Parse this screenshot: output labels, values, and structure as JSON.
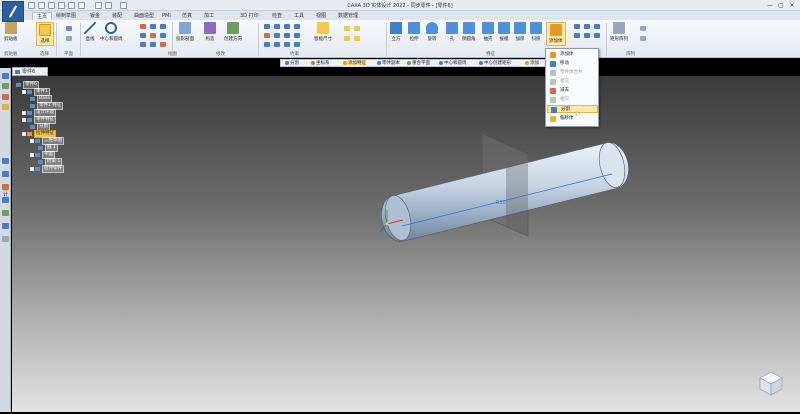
{
  "window": {
    "title": "CAXA 3D 实体设计 2022 - 同步零件 - [零件6]",
    "controls": [
      "—",
      "▢",
      "✕"
    ]
  },
  "tabs": [
    {
      "label": "主页",
      "active": true
    },
    {
      "label": "绘制草图"
    },
    {
      "label": "钣金"
    },
    {
      "label": "装配"
    },
    {
      "label": "曲面造型"
    },
    {
      "label": "PMI"
    },
    {
      "label": "仿真"
    },
    {
      "label": "加工"
    },
    {
      "label": "3D 打印"
    },
    {
      "label": "检查"
    },
    {
      "label": "工具"
    },
    {
      "label": "视图"
    },
    {
      "label": "数据管理"
    }
  ],
  "ribbon": {
    "buttons": {
      "clipboard": "剪贴板",
      "select": "选择",
      "line": "直线",
      "center_circle": "中心和圆周",
      "section_projection": "投影剖面",
      "project_ok": "构造",
      "create_direction": "创建方向",
      "smart_dimension": "智能尺寸",
      "cylinder": "立方",
      "stretch": "拉伸",
      "revolve": "旋转",
      "hole": "孔",
      "fillet": "倒圆角",
      "shell": "抽壳",
      "draft": "拔模",
      "thicken": "加厚",
      "sweep": "扫掠",
      "add_body": "添加体",
      "rect_array": "矩形阵列"
    },
    "groups": {
      "clipboard": "剪贴板",
      "select": "选择",
      "plane": "平面",
      "sketch": "绘图",
      "modify": "修改",
      "constraint": "约束",
      "features": "特征",
      "pattern": "阵列"
    }
  },
  "command_bar": {
    "items": [
      "分割",
      "坐标系",
      "添加特征",
      "零件副本",
      "重合平面",
      "中心和圆周",
      "中心创建矩形",
      "添加"
    ]
  },
  "document_tab": "零件6",
  "left_panel_label": "设计树",
  "tree": [
    {
      "label": "零件6",
      "indent": 0
    },
    {
      "label": "零件1",
      "indent": 1
    },
    {
      "label": "Base",
      "indent": 2
    },
    {
      "label": "零件1 特征",
      "indent": 2
    },
    {
      "label": "设计环境",
      "indent": 1
    },
    {
      "label": "零件特征",
      "indent": 1
    },
    {
      "label": "分割",
      "indent": 2
    },
    {
      "label": "拉伸特征",
      "indent": 1,
      "highlight": true
    },
    {
      "label": "二维草图",
      "indent": 2
    },
    {
      "label": "圆 1",
      "indent": 3
    },
    {
      "label": "平面",
      "indent": 2
    },
    {
      "label": "约束 1",
      "indent": 3
    },
    {
      "label": "拉伸零件",
      "indent": 2
    }
  ],
  "dropdown_menu": {
    "items": [
      {
        "label": "添加体",
        "disabled": false
      },
      {
        "label": "移动",
        "disabled": false
      },
      {
        "label": "零件体合并",
        "disabled": true
      },
      {
        "label": "相交",
        "disabled": true
      },
      {
        "label": "减去",
        "disabled": false
      },
      {
        "label": "相交",
        "disabled": true
      },
      {
        "label": "分割",
        "disabled": false,
        "hover": true
      },
      {
        "label": "偏移体",
        "disabled": false
      }
    ]
  },
  "viewport": {
    "dimension_label": "R10"
  },
  "colors": {
    "ribbon_bg": "#e9eef5",
    "selection_fill": "#fde9a4",
    "highlight_tree": "#f7c24f",
    "accent_blue": "#2f5f9e"
  }
}
